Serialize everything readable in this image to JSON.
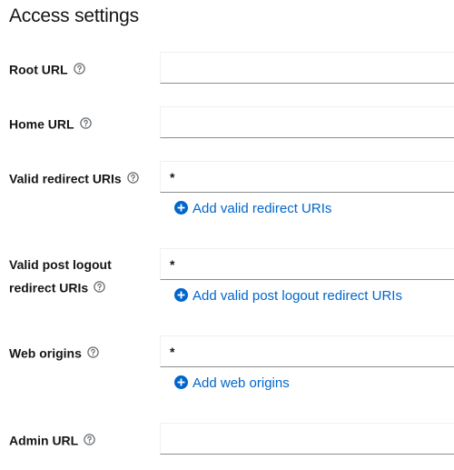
{
  "section": {
    "title": "Access settings"
  },
  "fields": {
    "root_url": {
      "label": "Root URL",
      "value": ""
    },
    "home_url": {
      "label": "Home URL",
      "value": ""
    },
    "valid_redirect_uris": {
      "label": "Valid redirect URIs",
      "value": "*",
      "add_label": "Add valid redirect URIs"
    },
    "valid_post_logout": {
      "label_line1": "Valid post logout",
      "label_line2": "redirect URIs",
      "value": "*",
      "add_label": "Add valid post logout redirect URIs"
    },
    "web_origins": {
      "label": "Web origins",
      "value": "*",
      "add_label": "Add web origins"
    },
    "admin_url": {
      "label": "Admin URL",
      "value": ""
    }
  },
  "icons": {
    "help": "help-circle-icon",
    "add": "plus-circle-icon"
  },
  "colors": {
    "link": "#0066cc",
    "text": "#151515",
    "icon": "#6a6e73",
    "field_border": "#8a8d90"
  }
}
